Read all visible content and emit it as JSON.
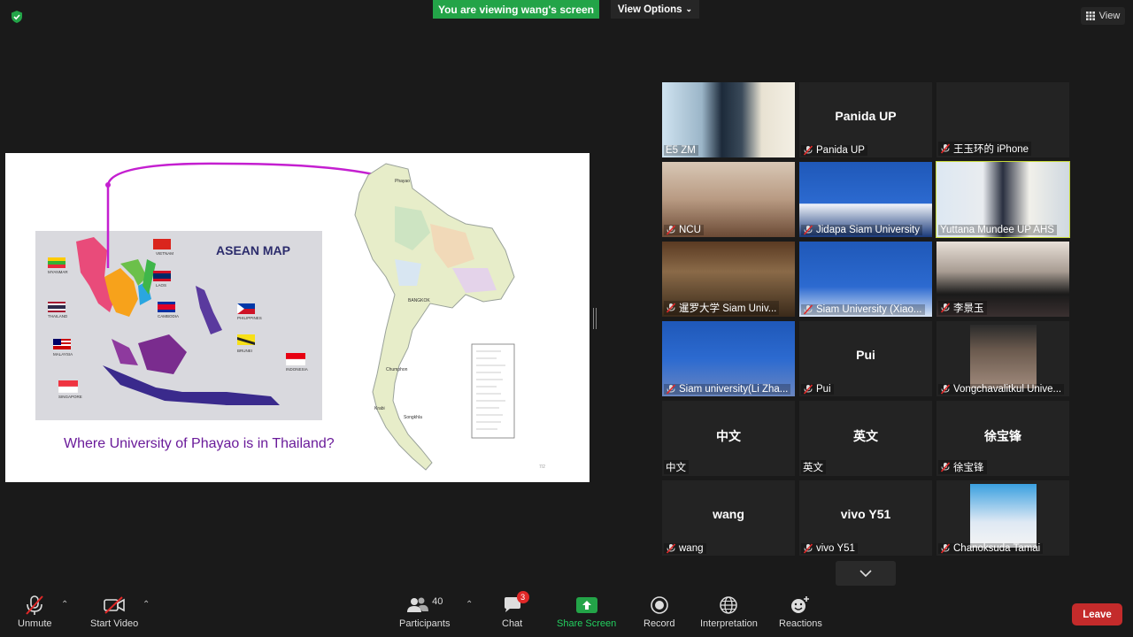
{
  "banner": {
    "text": "You are viewing wang's screen"
  },
  "view_options": {
    "label": "View Options"
  },
  "view_button": {
    "label": "View"
  },
  "slide": {
    "map_title": "ASEAN MAP",
    "question": "Where University of Phayao is in Thailand?",
    "countries": [
      "MYANMAR",
      "VIETNAM",
      "LAOS",
      "THAILAND",
      "CAMBODIA",
      "PHILIPPINES",
      "MALAYSIA",
      "BRUNEI",
      "INDONESIA",
      "SINGAPORE"
    ],
    "thai_labels": [
      "Phayao",
      "BANGKOK",
      "Chumphon",
      "Krabi",
      "Songkhla"
    ],
    "page_num": "7/2"
  },
  "participants": [
    {
      "name": "E5 ZM",
      "center": "",
      "muted": false,
      "video": true
    },
    {
      "name": "Panida UP",
      "center": "Panida UP",
      "muted": true,
      "video": false
    },
    {
      "name": "王玉环的 iPhone",
      "center": "",
      "muted": true,
      "video": false
    },
    {
      "name": "NCU",
      "center": "",
      "muted": true,
      "video": true
    },
    {
      "name": "Jidapa Siam University",
      "center": "",
      "muted": true,
      "video": true
    },
    {
      "name": "Yuttana Mundee UP AHS",
      "center": "",
      "muted": false,
      "video": true,
      "active": true
    },
    {
      "name": "暹罗大学 Siam Univ...",
      "center": "",
      "muted": true,
      "video": true
    },
    {
      "name": "Siam University (Xiao...",
      "center": "",
      "muted": true,
      "video": true
    },
    {
      "name": "李景玉",
      "center": "",
      "muted": true,
      "video": true
    },
    {
      "name": "Siam university(Li Zha...",
      "center": "",
      "muted": true,
      "video": true
    },
    {
      "name": "Pui",
      "center": "Pui",
      "muted": true,
      "video": false
    },
    {
      "name": "Vongchavalitkul Unive...",
      "center": "",
      "muted": true,
      "video": true
    },
    {
      "name": "中文",
      "center": "中文",
      "muted": false,
      "video": false
    },
    {
      "name": "英文",
      "center": "英文",
      "muted": false,
      "video": false
    },
    {
      "name": "徐宝锋",
      "center": "徐宝锋",
      "muted": true,
      "video": false
    },
    {
      "name": "wang",
      "center": "wang",
      "muted": true,
      "video": false
    },
    {
      "name": "vivo Y51",
      "center": "vivo Y51",
      "muted": true,
      "video": false
    },
    {
      "name": "Chanoksuda Tamai",
      "center": "",
      "muted": true,
      "video": true
    }
  ],
  "toolbar": {
    "unmute": "Unmute",
    "start_video": "Start Video",
    "participants": "Participants",
    "participants_count": "40",
    "chat": "Chat",
    "chat_badge": "3",
    "share_screen": "Share Screen",
    "record": "Record",
    "interpretation": "Interpretation",
    "reactions": "Reactions",
    "leave": "Leave"
  },
  "colors": {
    "share_green": "#23a448",
    "leave_red": "#c42b2b",
    "active_outline": "#c7d93a",
    "bg": "#1a1a1a",
    "tile": "#232323"
  }
}
